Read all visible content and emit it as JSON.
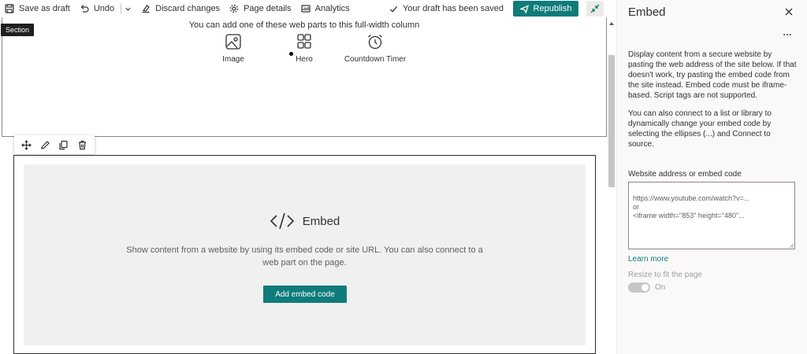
{
  "toolbar": {
    "save_draft": "Save as draft",
    "undo": "Undo",
    "discard": "Discard changes",
    "page_details": "Page details",
    "analytics": "Analytics",
    "saved_status": "Your draft has been saved",
    "republish": "Republish"
  },
  "section_tag": "Section",
  "toolbox": {
    "title": "You can add one of these web parts to this full-width column",
    "items": [
      {
        "label": "Image",
        "icon": "image-icon"
      },
      {
        "label": "Hero",
        "icon": "hero-icon"
      },
      {
        "label": "Countdown Timer",
        "icon": "countdown-timer-icon"
      }
    ]
  },
  "placeholder": {
    "title": "Embed",
    "description": "Show content from a website by using its embed code or site URL. You can also connect to a web part on the page.",
    "button": "Add embed code"
  },
  "pane": {
    "title": "Embed",
    "more": "…",
    "intro": "Display content from a secure website by pasting the web address of the site below. If that doesn't work, try pasting the embed code from the site instead. Embed code must be iframe-based. Script tags are not supported.",
    "connect": "You can also connect to a list or library to dynamically change your embed code by selecting the ellipses (...) and Connect to source.",
    "field_label": "Website address or embed code",
    "field_placeholder": "https://www.youtube.com/watch?v=...\nor\n<iframe width=\"853\" height=\"480\"...",
    "learn_more": "Learn more",
    "resize_label": "Resize to fit the page",
    "resize_state": "On"
  },
  "colors": {
    "accent": "#0f7b7b",
    "placeholder_bg": "#f0f0f0",
    "pane_bg": "#faf9f8"
  }
}
